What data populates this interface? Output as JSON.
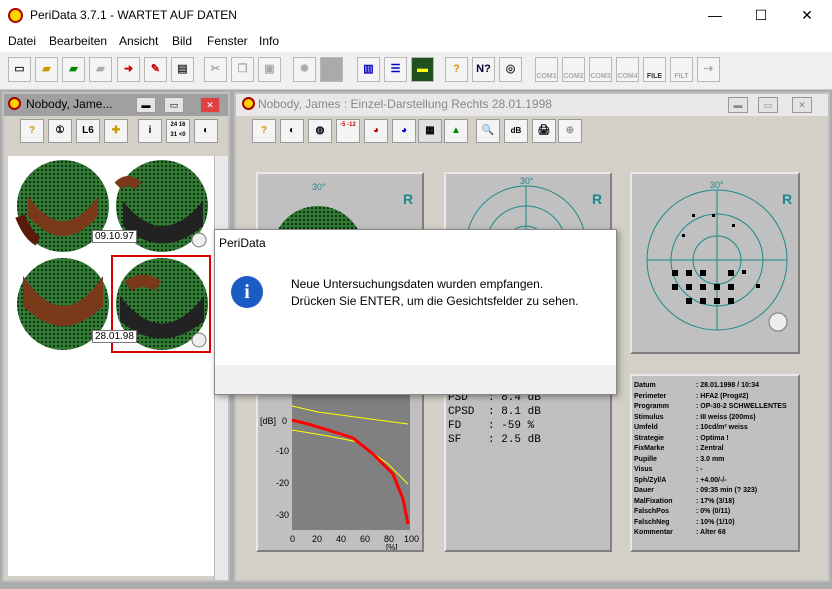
{
  "app": {
    "title": "PeriData 3.7.1 - WARTET AUF DATEN",
    "minimize": "—",
    "maximize": "☐",
    "close": "✕"
  },
  "menu": [
    "Datei",
    "Bearbeiten",
    "Ansicht",
    "Bild",
    "Fenster",
    "Info"
  ],
  "toolbar": {
    "com_labels": [
      "COM1",
      "COM2",
      "COM3",
      "COM4",
      "FILE",
      "FILT"
    ]
  },
  "left_window": {
    "title": "Nobody, Jame...",
    "buttons": [
      "?",
      "①",
      "L6",
      "✚",
      "i",
      "24 16 31 <0",
      "◐"
    ],
    "thumbs": [
      {
        "date": "09.10.97"
      },
      {
        "date": "28.01.98"
      }
    ]
  },
  "right_window": {
    "title": "Nobody, James :  Einzel-Darstellung  Rechts  28.01.1998",
    "buttons": [
      "?",
      "◐",
      "◍",
      "-5 -12",
      "◕",
      "◕",
      "▦",
      "▲",
      "🔍",
      "dB",
      "🖨",
      "⊕"
    ],
    "fields": [
      {
        "degree": "30°",
        "eye": "R"
      },
      {
        "degree": "30°",
        "eye": "R"
      },
      {
        "degree": "30°",
        "eye": "R"
      }
    ],
    "stats": [
      {
        "label": "PSD",
        "value": "8.4 dB"
      },
      {
        "label": "CPSD",
        "value": "8.1 dB"
      },
      {
        "label": "FD",
        "value": "-59 %"
      },
      {
        "label": "SF",
        "value": "2.5 dB"
      }
    ],
    "curve": {
      "unit": "[dB]",
      "xunit": "[%]",
      "yticks": [
        "0",
        "-10",
        "-20",
        "-30"
      ],
      "xticks": [
        "0",
        "20",
        "40",
        "60",
        "80",
        "100"
      ]
    },
    "info": [
      {
        "label": "Datum",
        "value": "28.01.1998 / 10:34"
      },
      {
        "label": "Perimeter",
        "value": "HFA2 (Prog#2)"
      },
      {
        "label": "Programm",
        "value": "OP-30-2 SCHWELLENTES"
      },
      {
        "label": "Stimulus",
        "value": "III weiss (200ms)"
      },
      {
        "label": "Umfeld",
        "value": "10cd/m² weiss"
      },
      {
        "label": "Strategie",
        "value": "Optima !"
      },
      {
        "label": "FixMarke",
        "value": "Zentral"
      },
      {
        "label": "Pupille",
        "value": "3.0 mm"
      },
      {
        "label": "Visus",
        "value": "-"
      },
      {
        "label": "Sph/Zyl/A",
        "value": "+4.00/-/-"
      },
      {
        "label": "Dauer",
        "value": "09:35 min (? 323)"
      },
      {
        "label": "MalFixation",
        "value": "17% (3/18)"
      },
      {
        "label": "FalschPos",
        "value": "0% (0/11)"
      },
      {
        "label": "FalschNeg",
        "value": "10% (1/10)"
      },
      {
        "label": "Kommentar",
        "value": "Alter 68"
      }
    ]
  },
  "dialog": {
    "title": "PeriData",
    "message": "Neue Untersuchungsdaten wurden empfangen. Drücken Sie ENTER, um die Gesichtsfelder zu sehen."
  },
  "colors": {
    "accent": "#1b8a8a",
    "curve_red": "#ff0000",
    "curve_yellow": "#ffff00"
  }
}
